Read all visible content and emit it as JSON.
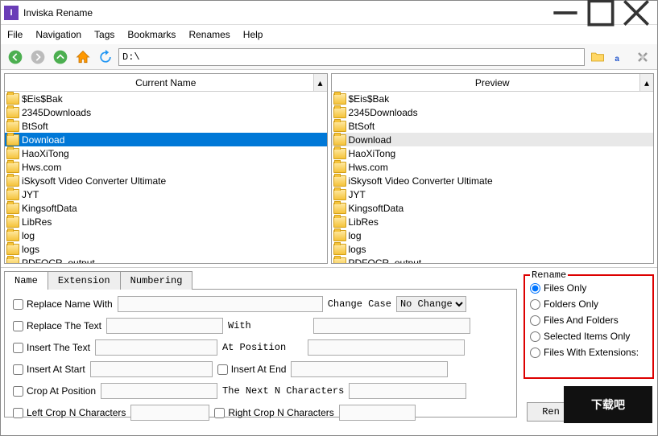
{
  "window": {
    "title": "Inviska Rename"
  },
  "menu": {
    "file": "File",
    "navigation": "Navigation",
    "tags": "Tags",
    "bookmarks": "Bookmarks",
    "renames": "Renames",
    "help": "Help"
  },
  "address": "D:\\",
  "panes": {
    "current_header": "Current Name",
    "preview_header": "Preview"
  },
  "files": [
    "$Eis$Bak",
    "2345Downloads",
    "BtSoft",
    "Download",
    "HaoXiTong",
    "Hws.com",
    "iSkysoft Video Converter Ultimate",
    "JYT",
    "KingsoftData",
    "LibRes",
    "log",
    "logs",
    "PDFOCR_output"
  ],
  "selected_index": 3,
  "tabs": {
    "name": "Name",
    "extension": "Extension",
    "numbering": "Numbering"
  },
  "form": {
    "replace_name_with": "Replace Name With",
    "change_case": "Change Case",
    "no_change": "No Change",
    "replace_the_text": "Replace The Text",
    "with": "With",
    "insert_the_text": "Insert The Text",
    "at_position": "At Position",
    "insert_at_start": "Insert At Start",
    "insert_at_end": "Insert At End",
    "crop_at_position": "Crop At Position",
    "next_n_chars": "The Next N Characters",
    "left_crop": "Left Crop N Characters",
    "right_crop": "Right Crop N Characters"
  },
  "rename": {
    "title": "Rename",
    "files_only": "Files Only",
    "folders_only": "Folders Only",
    "files_and_folders": "Files And Folders",
    "selected_items_only": "Selected Items Only",
    "files_with_ext": "Files With Extensions:",
    "button": "Ren"
  },
  "watermark": "下载吧"
}
